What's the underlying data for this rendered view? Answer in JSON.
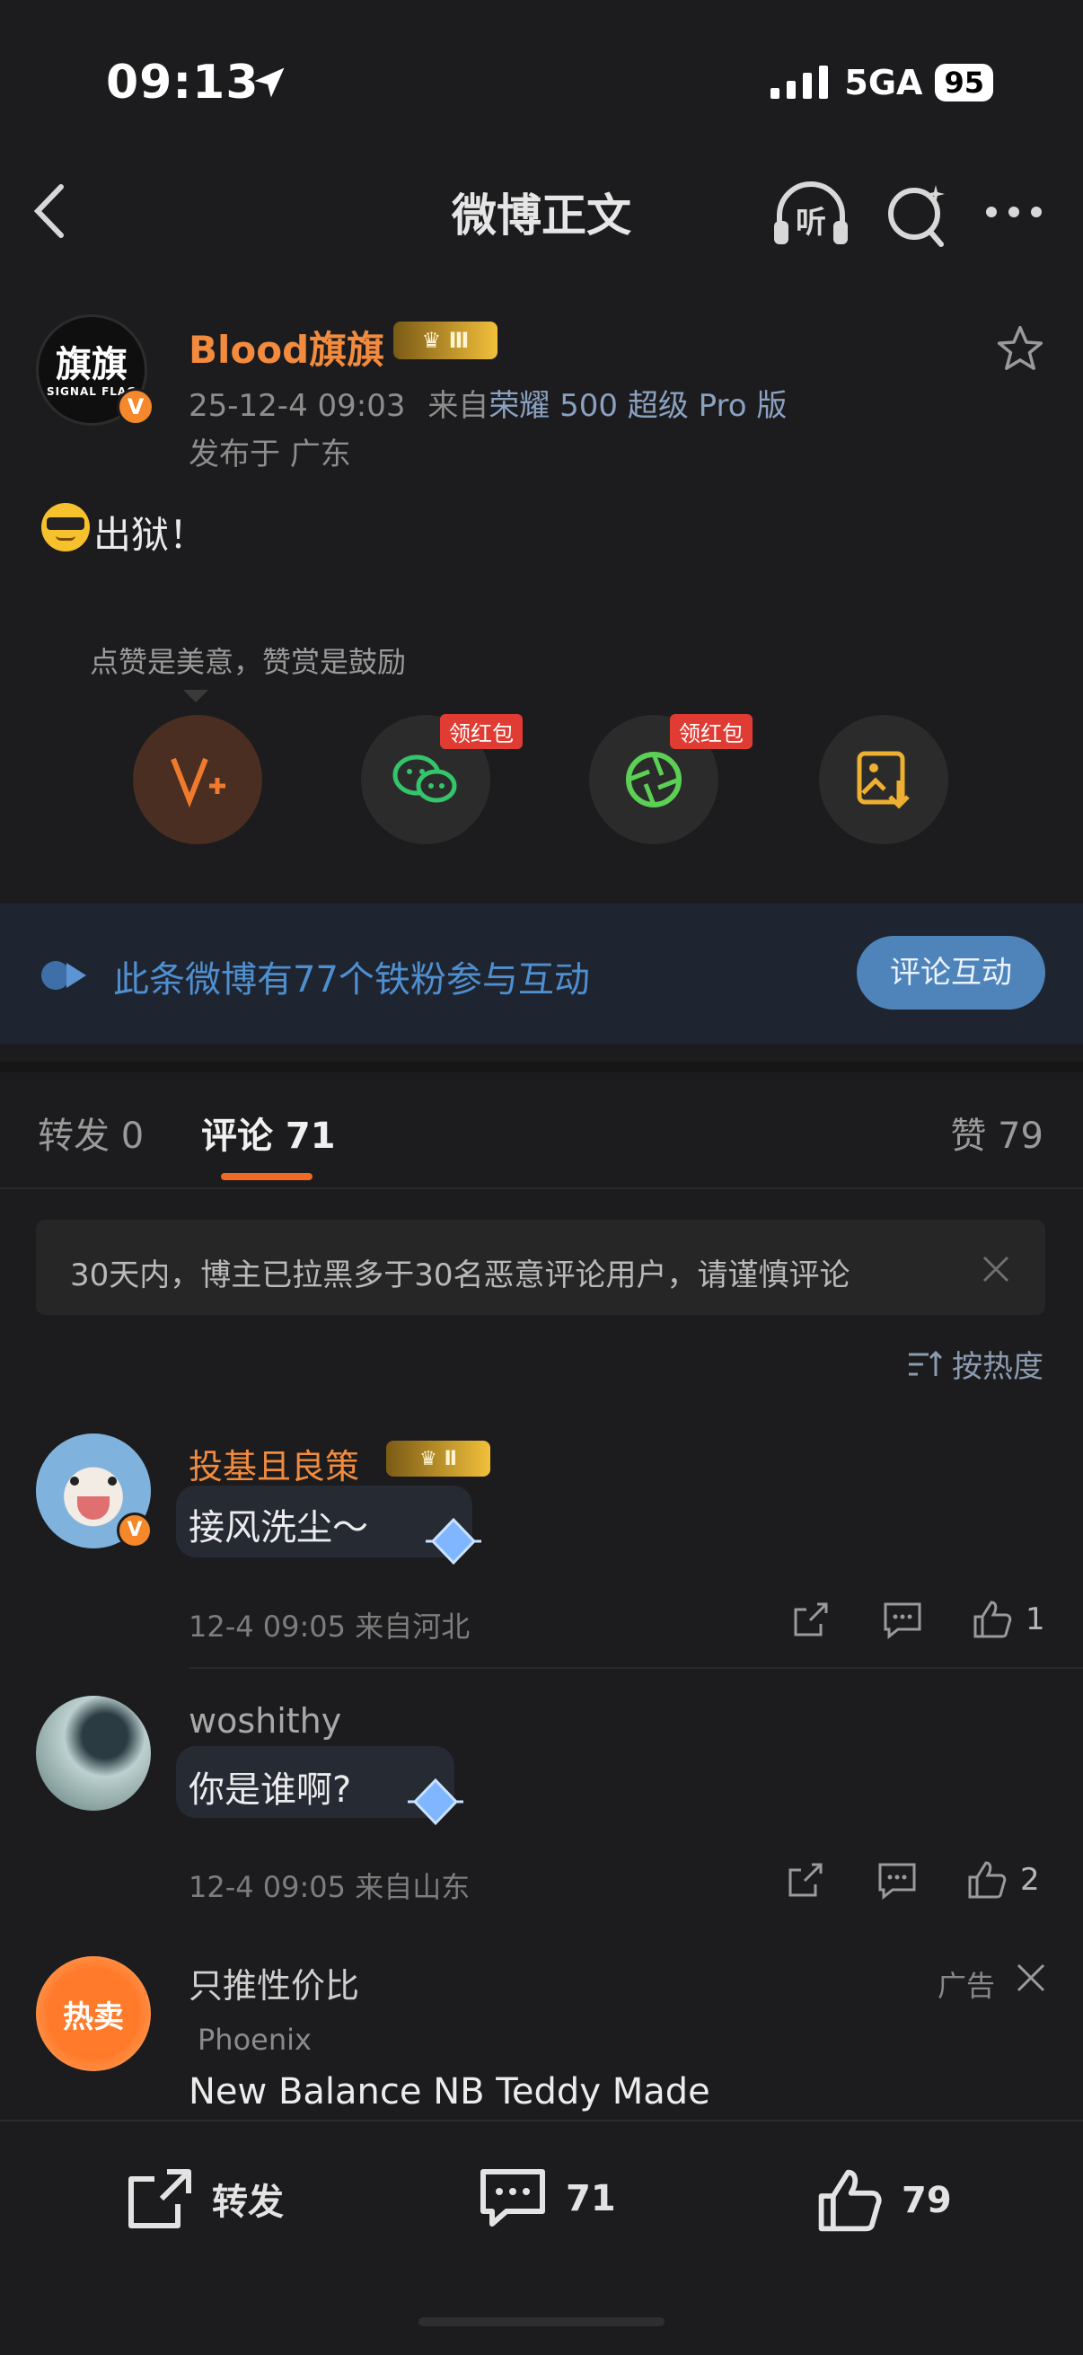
{
  "status_bar": {
    "time": "09:13",
    "network": "5GA",
    "battery": "95"
  },
  "nav": {
    "title": "微博正文",
    "listen_label": "听"
  },
  "post": {
    "author": "Blood旗旗",
    "avatar_text": "旗旗",
    "avatar_subtext": "SIGNAL FLAG",
    "timestamp": "25-12-4 09:03",
    "source_prefix": "来自",
    "source": "荣耀 500 超级 Pro 版",
    "location": "发布于 广东",
    "content": "出狱！"
  },
  "tip": {
    "hint": "点赞是美意，赞赏是鼓励",
    "red_packet_label": "领红包"
  },
  "fan_banner": {
    "text": "此条微博有77个铁粉参与互动",
    "button": "评论互动"
  },
  "tabs": {
    "repost": "转发 0",
    "comment": "评论 71",
    "like": "赞 79"
  },
  "notice": {
    "text": "30天内，博主已拉黑多于30名恶意评论用户，请谨慎评论"
  },
  "sort": {
    "label": "按热度"
  },
  "comments": [
    {
      "user": "投基且良策",
      "text": "接风洗尘～",
      "meta": "12-4 09:05 来自河北",
      "likes": "1"
    },
    {
      "user": "woshithy",
      "text": "你是谁啊?",
      "meta": "12-4 09:05 来自山东",
      "likes": "2"
    }
  ],
  "ad": {
    "title": "只推性价比",
    "label": "广告",
    "brand": "Phoenix",
    "text": "New Balance NB Teddy Made",
    "badge": "热卖"
  },
  "bottom_bar": {
    "repost": "转发",
    "comments": "71",
    "likes": "79"
  },
  "colors": {
    "accent": "#f28b3e",
    "link": "#4f8fd0",
    "background": "#1c1c1e"
  }
}
